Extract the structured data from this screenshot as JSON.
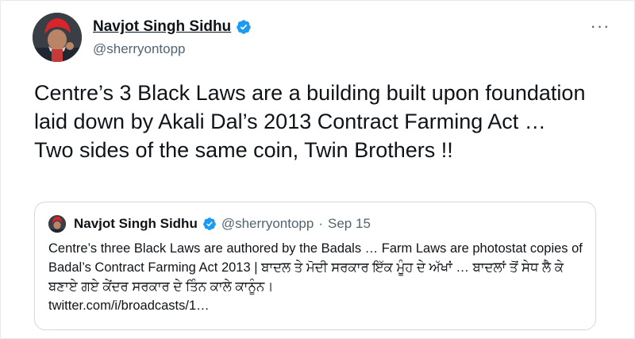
{
  "tweet": {
    "author": {
      "display_name": "Navjot Singh Sidhu",
      "handle": "@sherryontopp",
      "verified": true
    },
    "more_label": "···",
    "text": "Centre’s 3 Black Laws are a building built upon foundation laid down by Akali Dal’s 2013 Contract Farming Act … Two sides of the same coin, Twin Brothers !!",
    "quoted_tweet": {
      "author": {
        "display_name": "Navjot Singh Sidhu",
        "handle": "@sherryontopp",
        "verified": true
      },
      "separator": "·",
      "date": "Sep 15",
      "text": "Centre’s three Black Laws are authored by the Badals … Farm Laws are photostat copies of Badal’s Contract Farming Act 2013 | ਬਾਦਲ ਤੇ ਮੋਦੀ ਸਰਕਾਰ ਇੱਕ ਮੂੰਹ ਦੇ ਅੱਖਾਂ … ਬਾਦਲਾਂ ਤੋਂ ਸੇਧ ਲੈ ਕੇ ਬਣਾਏ ਗਏ ਕੇਂਦਰ ਸਰਕਾਰ ਦੇ ਤਿੰਨ ਕਾਲੇ ਕਾਨੂੰਨ।",
      "link_text": "twitter.com/i/broadcasts/1…"
    }
  },
  "colors": {
    "text_primary": "#0f1419",
    "text_secondary": "#536471",
    "verified_blue": "#1d9bf0",
    "border": "#cfd9de",
    "turban_red": "#d9242b"
  },
  "icons": {
    "verified": "verified-badge-icon",
    "more": "more-horizontal-icon"
  }
}
